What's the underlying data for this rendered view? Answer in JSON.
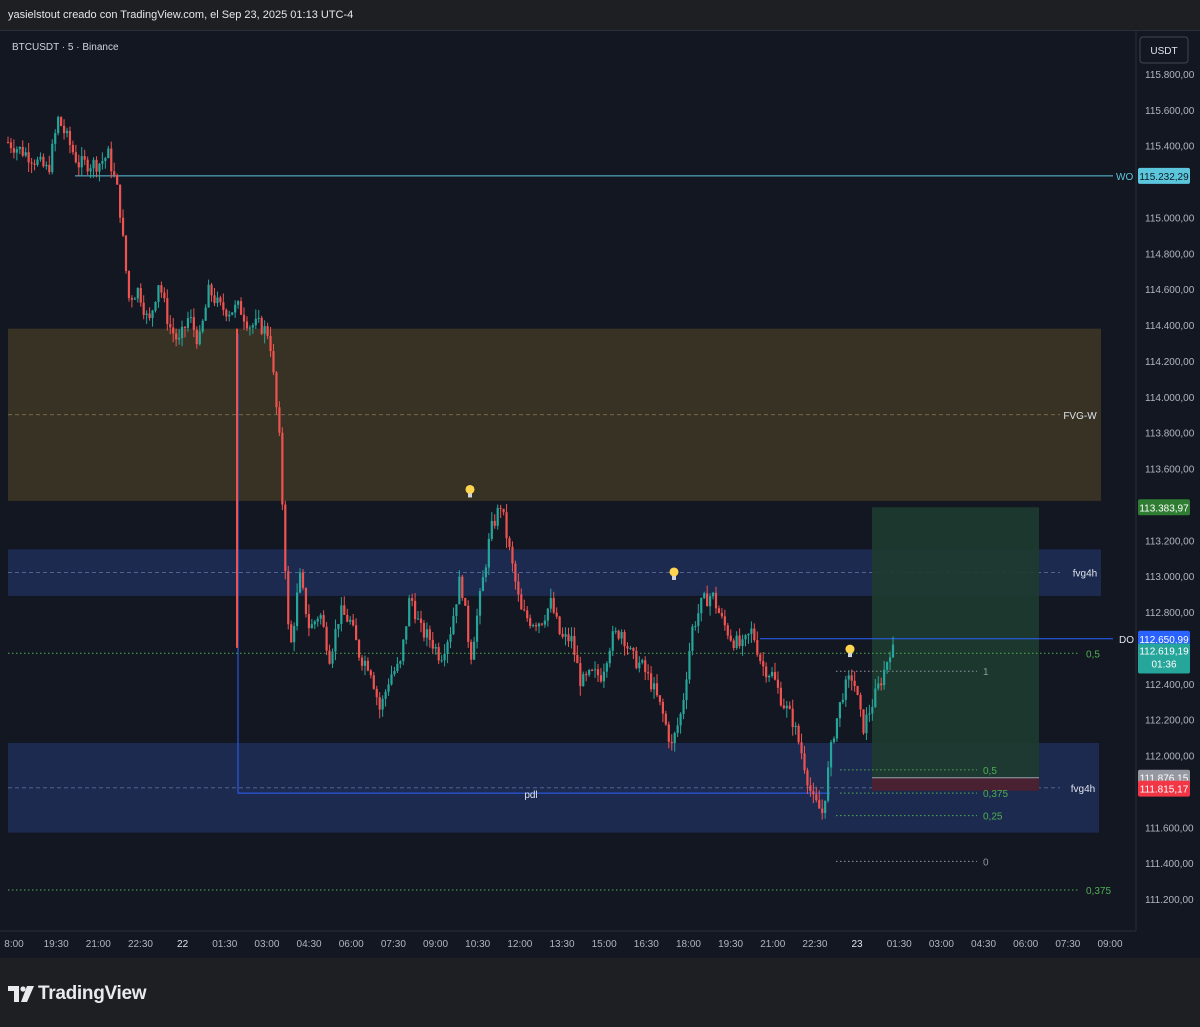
{
  "header": {
    "caption": "yasielstout creado con TradingView.com, el Sep 23, 2025 01:13 UTC-4"
  },
  "symbol": {
    "label": "BTCUSDT · 5 · Binance",
    "currency": "USDT"
  },
  "colors": {
    "background": "#131722",
    "up": "#26a69a",
    "down": "#ef5350",
    "fvg_weekly_zone": "#3a3426",
    "fvg_4h_zone": "#1d2a4f",
    "target_zone": "#1e3b2f",
    "stop_zone": "#4a2130",
    "wo_line": "#5cc6dd",
    "do_line": "#2962ff",
    "fib_line": "#4caf50"
  },
  "chart_data": {
    "type": "candlestick",
    "title": "",
    "y_range": [
      111100,
      115900
    ],
    "y_ticks": [
      "115.800,00",
      "115.600,00",
      "115.400,00",
      "115.000,00",
      "114.800,00",
      "114.600,00",
      "114.400,00",
      "114.200,00",
      "114.000,00",
      "113.800,00",
      "113.600,00",
      "113.200,00",
      "113.000,00",
      "112.800,00",
      "112.400,00",
      "112.200,00",
      "112.000,00",
      "111.600,00",
      "111.400,00",
      "111.200,00"
    ],
    "x_ticks": [
      "8:00",
      "19:30",
      "21:00",
      "22:30",
      "22",
      "01:30",
      "03:00",
      "04:30",
      "06:00",
      "07:30",
      "09:00",
      "10:30",
      "12:00",
      "13:30",
      "15:00",
      "16:30",
      "18:00",
      "19:30",
      "21:00",
      "22:30",
      "23",
      "01:30",
      "03:00",
      "04:30",
      "06:00",
      "07:30",
      "09:00"
    ],
    "price_path": [
      [
        0,
        115420
      ],
      [
        2,
        115350
      ],
      [
        4,
        115260
      ],
      [
        5,
        115550
      ],
      [
        7,
        115300
      ],
      [
        9,
        115300
      ],
      [
        10,
        115350
      ],
      [
        11,
        115120
      ],
      [
        12,
        114550
      ],
      [
        13,
        114600
      ],
      [
        14,
        114400
      ],
      [
        15,
        114650
      ],
      [
        16,
        114400
      ],
      [
        17,
        114300
      ],
      [
        18,
        114450
      ],
      [
        19,
        114300
      ],
      [
        20,
        114600
      ],
      [
        21,
        114500
      ],
      [
        22,
        114480
      ],
      [
        23,
        114500
      ],
      [
        24,
        114400
      ],
      [
        25,
        114400
      ],
      [
        26,
        114350
      ],
      [
        27,
        113750
      ],
      [
        28,
        112550
      ],
      [
        29,
        113000
      ],
      [
        30,
        112700
      ],
      [
        31,
        112800
      ],
      [
        32,
        112550
      ],
      [
        33,
        112800
      ],
      [
        34,
        112750
      ],
      [
        35,
        112550
      ],
      [
        36,
        112500
      ],
      [
        37,
        112250
      ],
      [
        38,
        112450
      ],
      [
        39,
        112500
      ],
      [
        40,
        112900
      ],
      [
        41,
        112700
      ],
      [
        42,
        112650
      ],
      [
        43,
        112550
      ],
      [
        44,
        112700
      ],
      [
        45,
        113000
      ],
      [
        46,
        112550
      ],
      [
        47,
        112900
      ],
      [
        48,
        113250
      ],
      [
        49,
        113400
      ],
      [
        50,
        113100
      ],
      [
        51,
        112800
      ],
      [
        52,
        112750
      ],
      [
        53,
        112750
      ],
      [
        54,
        112850
      ],
      [
        55,
        112650
      ],
      [
        56,
        112650
      ],
      [
        57,
        112400
      ],
      [
        58,
        112450
      ],
      [
        59,
        112450
      ],
      [
        60,
        112650
      ],
      [
        61,
        112700
      ],
      [
        62,
        112550
      ],
      [
        63,
        112500
      ],
      [
        64,
        112400
      ],
      [
        65,
        112250
      ],
      [
        66,
        112050
      ],
      [
        67,
        112250
      ],
      [
        68,
        112700
      ],
      [
        69,
        112850
      ],
      [
        70,
        112900
      ],
      [
        71,
        112750
      ],
      [
        72,
        112650
      ],
      [
        73,
        112600
      ],
      [
        74,
        112700
      ],
      [
        75,
        112500
      ],
      [
        76,
        112450
      ],
      [
        77,
        112300
      ],
      [
        78,
        112200
      ],
      [
        79,
        112000
      ],
      [
        80,
        111750
      ],
      [
        81,
        111680
      ],
      [
        82,
        112100
      ],
      [
        83,
        112350
      ],
      [
        84,
        112450
      ],
      [
        85,
        112150
      ],
      [
        86,
        112300
      ],
      [
        87,
        112450
      ],
      [
        88,
        112650
      ]
    ],
    "levels": {
      "wo": {
        "label": "WO",
        "price_label": "115.232,29"
      },
      "do": {
        "label": "DO",
        "price_label": "112.650,99"
      },
      "fvg_weekly": {
        "label": "FVG-W",
        "from": 113420,
        "to": 114380
      },
      "fvg_4h_upper": {
        "label": "fvg4h",
        "from": 112890,
        "to": 113150
      },
      "fvg_4h_lower": {
        "label": "fvg4h",
        "from": 111570,
        "to": 112070
      },
      "pdl": {
        "label": "pdl"
      }
    },
    "price_labels": {
      "target": "113.383,97",
      "current": "112.619,19",
      "countdown": "01:36",
      "entry": "111.876,15",
      "stop": "111.815,17"
    },
    "fib_labels": [
      "1",
      "0,5",
      "0,375",
      "0,25",
      "0",
      "0,5",
      "0,375"
    ]
  },
  "brand": {
    "name": "TradingView"
  }
}
